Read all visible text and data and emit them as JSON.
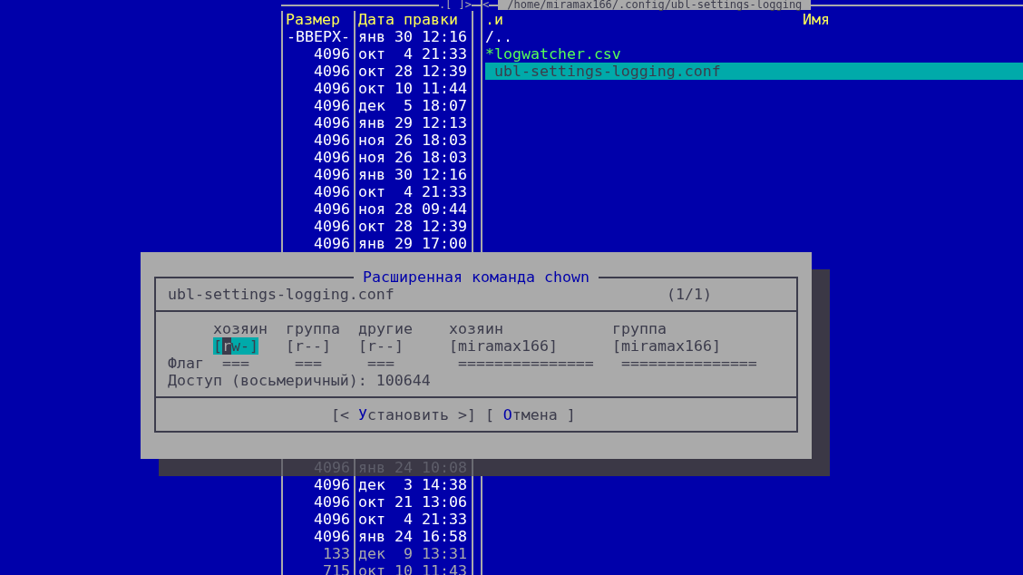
{
  "left_panel": {
    "frame_buttons": ".[ ]>",
    "columns": [
      "Размер",
      "Дата правки"
    ],
    "rows": [
      {
        "size": "-ВВЕРХ-",
        "date": "янв 30 12:16",
        "kind": "dir",
        "shadowed": false
      },
      {
        "size": "4096",
        "date": "окт  4 21:33",
        "kind": "dir",
        "shadowed": false
      },
      {
        "size": "4096",
        "date": "окт 28 12:39",
        "kind": "dir",
        "shadowed": false
      },
      {
        "size": "4096",
        "date": "окт 10 11:44",
        "kind": "dir",
        "shadowed": false
      },
      {
        "size": "4096",
        "date": "дек  5 18:07",
        "kind": "dir",
        "shadowed": false
      },
      {
        "size": "4096",
        "date": "янв 29 12:13",
        "kind": "dir",
        "shadowed": false
      },
      {
        "size": "4096",
        "date": "ноя 26 18:03",
        "kind": "dir",
        "shadowed": false
      },
      {
        "size": "4096",
        "date": "ноя 26 18:03",
        "kind": "dir",
        "shadowed": false
      },
      {
        "size": "4096",
        "date": "янв 30 12:16",
        "kind": "dir",
        "shadowed": false
      },
      {
        "size": "4096",
        "date": "окт  4 21:33",
        "kind": "dir",
        "shadowed": false
      },
      {
        "size": "4096",
        "date": "ноя 28 09:44",
        "kind": "dir",
        "shadowed": false
      },
      {
        "size": "4096",
        "date": "окт 28 12:39",
        "kind": "dir",
        "shadowed": false
      },
      {
        "size": "4096",
        "date": "янв 29 17:00",
        "kind": "dir",
        "shadowed": false
      }
    ],
    "rows_after_dialog": [
      {
        "size": "4096",
        "date": "янв 24 10:08",
        "kind": "dir",
        "shadowed": true
      },
      {
        "size": "4096",
        "date": "дек  3 14:38",
        "kind": "dir",
        "shadowed": false
      },
      {
        "size": "4096",
        "date": "окт 21 13:06",
        "kind": "dir",
        "shadowed": false
      },
      {
        "size": "4096",
        "date": "окт  4 21:33",
        "kind": "dir",
        "shadowed": false
      },
      {
        "size": "4096",
        "date": "янв 24 16:58",
        "kind": "dir",
        "shadowed": false
      },
      {
        "size": "133",
        "date": "дек  9 13:31",
        "kind": "file",
        "shadowed": false
      },
      {
        "size": "715",
        "date": "окт 10 11:43",
        "kind": "file",
        "shadowed": false
      }
    ]
  },
  "right_panel": {
    "frame_button": "<",
    "path": "/home/miramax166/.config/ubl-settings-logging",
    "sort_mark": ".и",
    "column": "Имя",
    "rows": [
      {
        "name": "/..",
        "kind": "dir",
        "selected": false
      },
      {
        "name": "*logwatcher.csv",
        "kind": "exec",
        "selected": false
      },
      {
        "name": "ubl-settings-logging.conf",
        "kind": "file",
        "selected": true
      }
    ]
  },
  "dialog": {
    "title": "Расширенная команда chown",
    "file": "ubl-settings-logging.conf",
    "counter": "(1/1)",
    "columns": [
      {
        "label": "хозяин",
        "value": "[rw-]",
        "flag": "===",
        "selected": true
      },
      {
        "label": "группа",
        "value": "[r--]",
        "flag": "===",
        "selected": false
      },
      {
        "label": "другие",
        "value": "[r--]",
        "flag": "===",
        "selected": false
      },
      {
        "label": "хозяин",
        "value": "[miramax166]",
        "flag": "===============",
        "selected": false
      },
      {
        "label": "группа",
        "value": "[miramax166]",
        "flag": "===============",
        "selected": false
      }
    ],
    "flag_label": "Флаг",
    "octal": "Доступ (восьмеричный): 100644",
    "buttons": [
      {
        "before": "[< ",
        "hotkey": "У",
        "after": "становить >]"
      },
      {
        "before": "[ ",
        "hotkey": "О",
        "after": "тмена ]"
      }
    ]
  }
}
